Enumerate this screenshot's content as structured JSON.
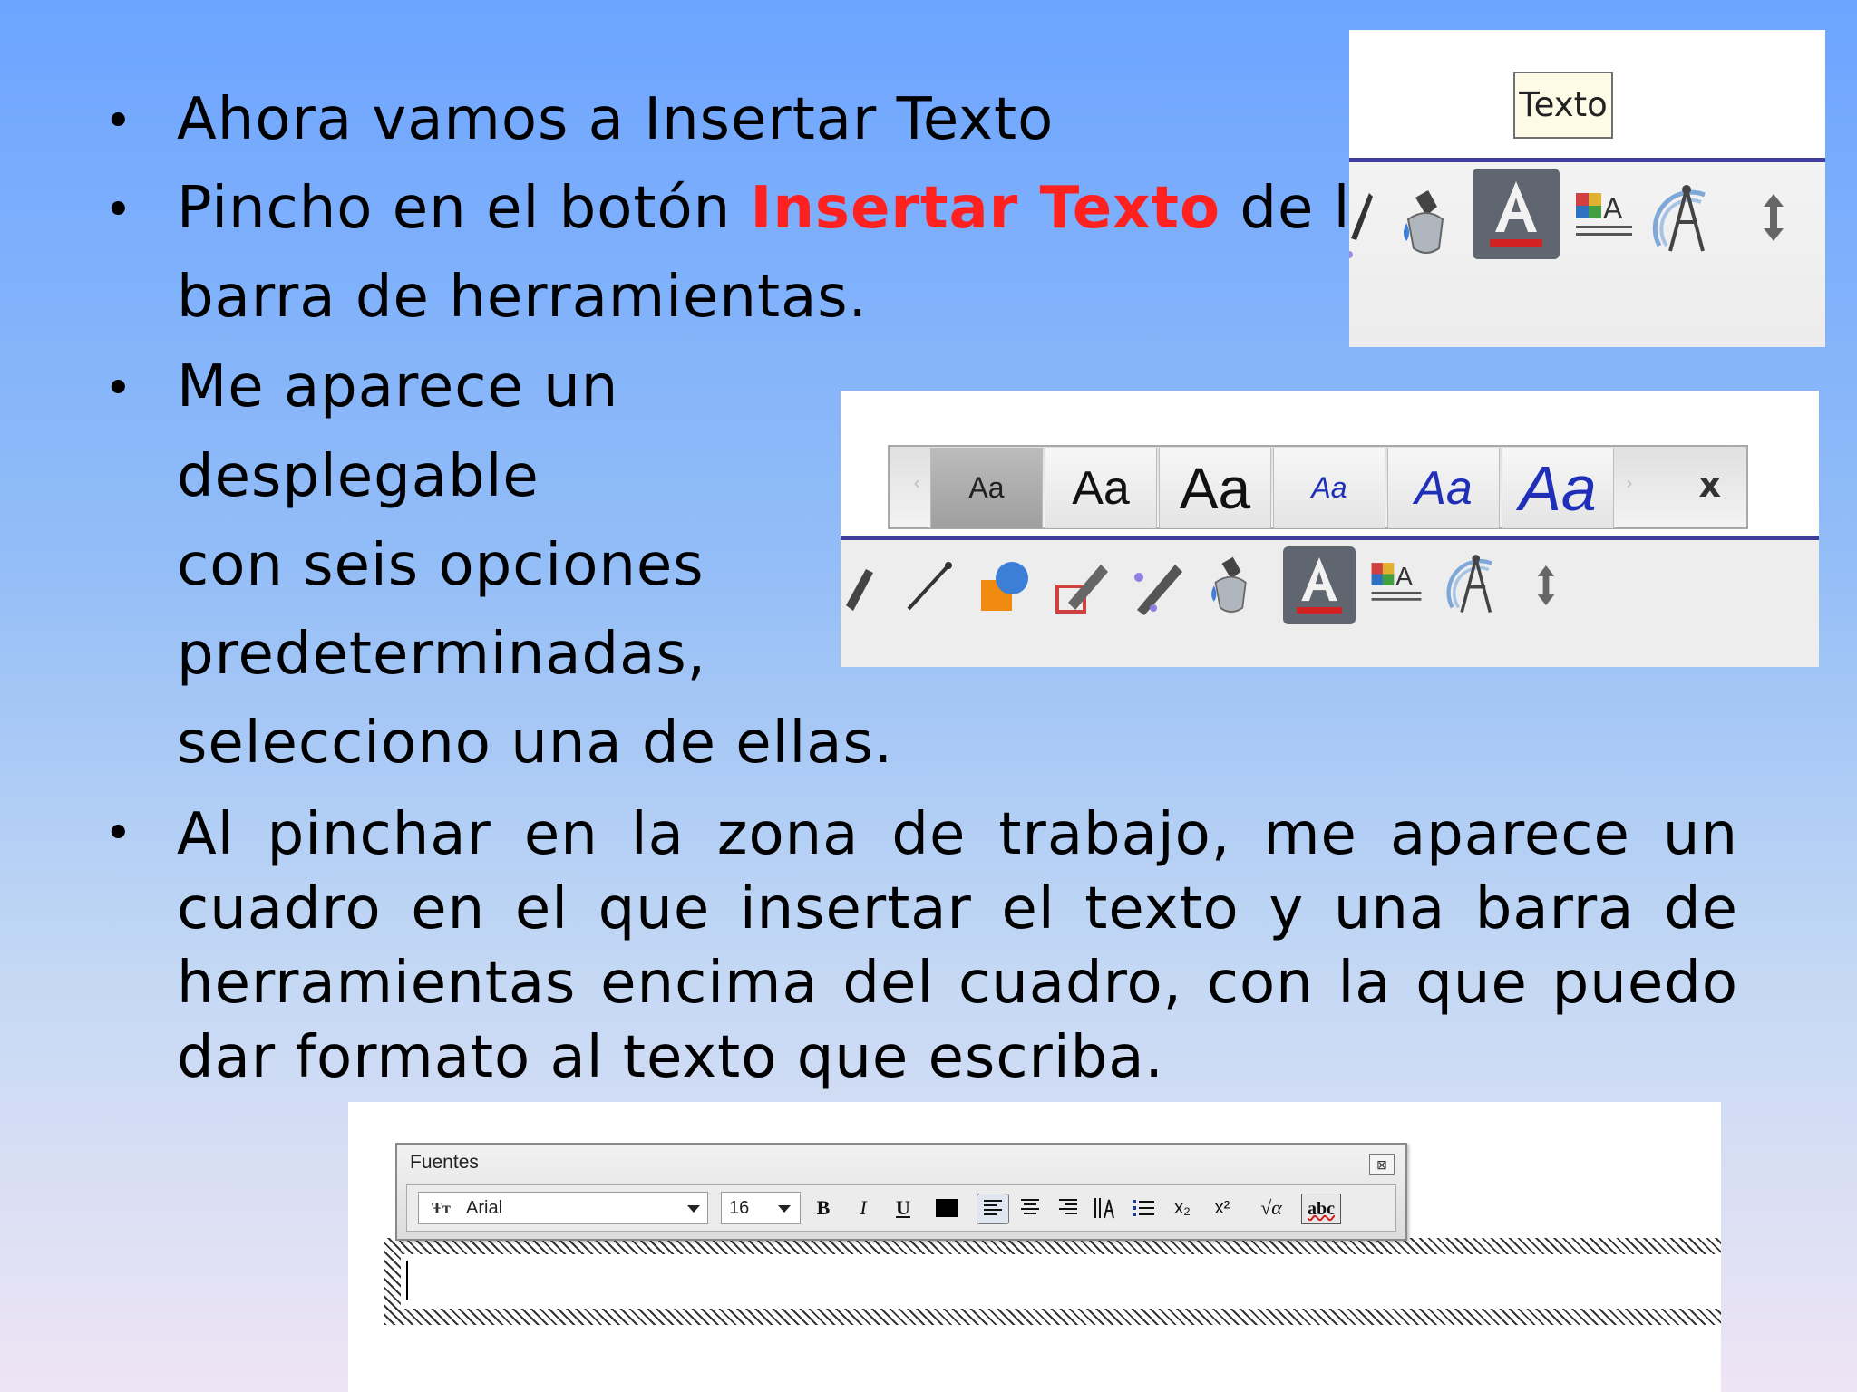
{
  "slide": {
    "bullets": [
      {
        "text": "Ahora vamos a Insertar Texto"
      },
      {
        "before": "Pincho en el botón ",
        "highlight": "Insertar Texto",
        "after": " de la",
        "continuation": "barra de herramientas."
      },
      {
        "lines": [
          "Me aparece un",
          "desplegable",
          "con seis opciones",
          "predeterminadas,",
          "selecciono una de ellas."
        ]
      },
      {
        "text": "Al pinchar en la zona de trabajo, me aparece un cuadro en el que insertar el texto y una barra de herramientas encima del cuadro, con la que puedo dar formato al texto que escriba."
      }
    ],
    "highlight_color": "#ff2020"
  },
  "screenshot1": {
    "tooltip": "Texto",
    "tools": [
      "pencil-icon",
      "paint-bucket-icon",
      "insert-text-icon",
      "image-icon",
      "compass-icon",
      "move-arrows-icon"
    ]
  },
  "screenshot2": {
    "style_options": [
      "Aa",
      "Aa",
      "Aa",
      "Aa",
      "Aa",
      "Aa"
    ],
    "close": "x",
    "tools": [
      "eraser-icon",
      "line-icon",
      "shapes-icon",
      "pencil-icon",
      "magic-pen-icon",
      "paint-bucket-icon",
      "insert-text-icon",
      "image-icon",
      "compass-icon",
      "move-arrows-icon"
    ]
  },
  "screenshot3": {
    "title": "Fuentes",
    "close": "⊠",
    "font_icon": "Ŧт",
    "font_name": "Arial",
    "font_size": "16",
    "buttons": {
      "bold": "B",
      "italic": "I",
      "underline": "U",
      "subscript": "x₂",
      "superscript": "x²",
      "equation": "√α",
      "spellcheck": "abc"
    }
  }
}
